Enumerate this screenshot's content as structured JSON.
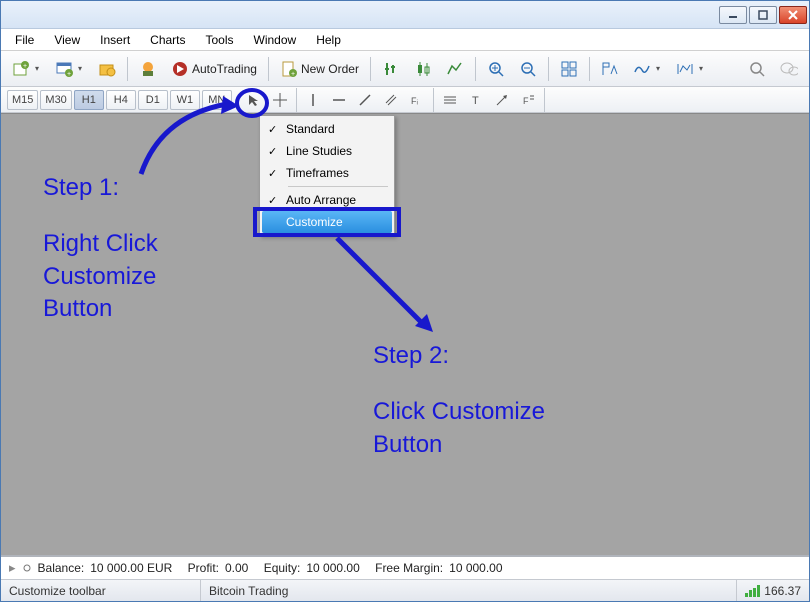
{
  "window": {
    "title": ""
  },
  "menu": {
    "items": [
      "File",
      "View",
      "Insert",
      "Charts",
      "Tools",
      "Window",
      "Help"
    ]
  },
  "toolbar1": {
    "autotrading_label": "AutoTrading",
    "neworder_label": "New Order"
  },
  "timeframes": {
    "items": [
      "M15",
      "M30",
      "H1",
      "H4",
      "D1",
      "W1",
      "MN"
    ],
    "active": "H1"
  },
  "context_menu": {
    "items": [
      {
        "label": "Standard",
        "checked": true
      },
      {
        "label": "Line Studies",
        "checked": true
      },
      {
        "label": "Timeframes",
        "checked": true
      }
    ],
    "autoarrange_label": "Auto Arrange",
    "customize_label": "Customize"
  },
  "annotations": {
    "step1_title": "Step 1:",
    "step1_body": "Right Click Customize Button",
    "step2_title": "Step 2:",
    "step2_body": "Click Customize Button"
  },
  "terminal": {
    "balance_label": "Balance:",
    "balance_value": "10 000.00 EUR",
    "profit_label": "Profit:",
    "profit_value": "0.00",
    "equity_label": "Equity:",
    "equity_value": "10 000.00",
    "freemargin_label": "Free Margin:",
    "freemargin_value": "10 000.00"
  },
  "status": {
    "left": "Customize toolbar",
    "center": "Bitcoin Trading",
    "right": "166.37"
  }
}
